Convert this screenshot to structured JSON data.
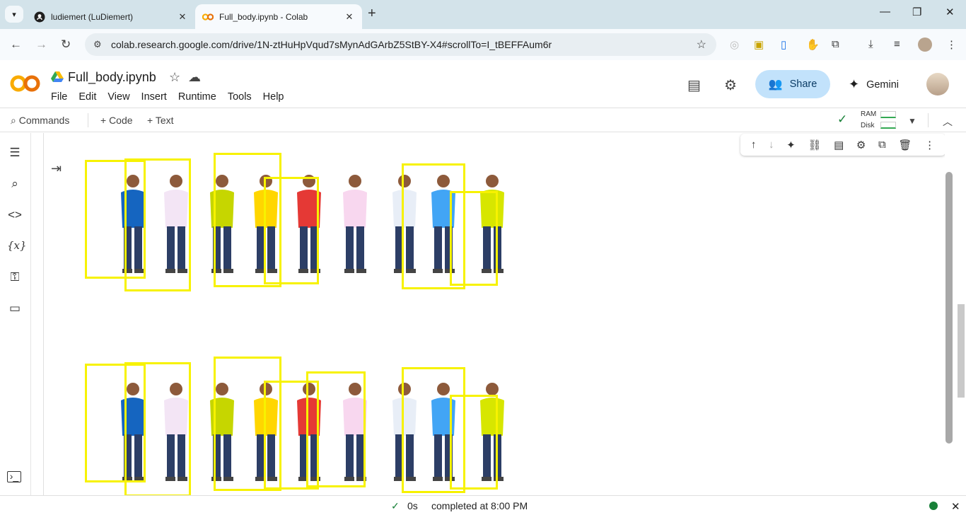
{
  "browser": {
    "tabs": [
      {
        "title": "ludiemert (LuDiemert)",
        "icon": "github-icon"
      },
      {
        "title": "Full_body.ipynb - Colab",
        "icon": "colab-icon",
        "active": true
      }
    ],
    "url": "colab.research.google.com/drive/1N-ztHuHpVqud7sMynAdGArbZ5StBY-X4#scrollTo=I_tBEFFAum6r"
  },
  "notebook": {
    "filename": "Full_body.ipynb",
    "menu": [
      "File",
      "Edit",
      "View",
      "Insert",
      "Runtime",
      "Tools",
      "Help"
    ],
    "share_label": "Share",
    "gemini_label": "Gemini"
  },
  "toolbar": {
    "commands_label": "Commands",
    "code_label": "+ Code",
    "text_label": "+ Text",
    "ram_label": "RAM",
    "disk_label": "Disk"
  },
  "status": {
    "time": "0s",
    "message": "completed at 8:00 PM"
  },
  "figures": {
    "people_shirt_colors": [
      "#1565c0",
      "#f3e5f5",
      "#c6d600",
      "#ffd600",
      "#e53935",
      "#f8d7ef",
      "#e8eef7",
      "#42a5f5",
      "#d7e600"
    ],
    "box_color": "#f7f200"
  }
}
